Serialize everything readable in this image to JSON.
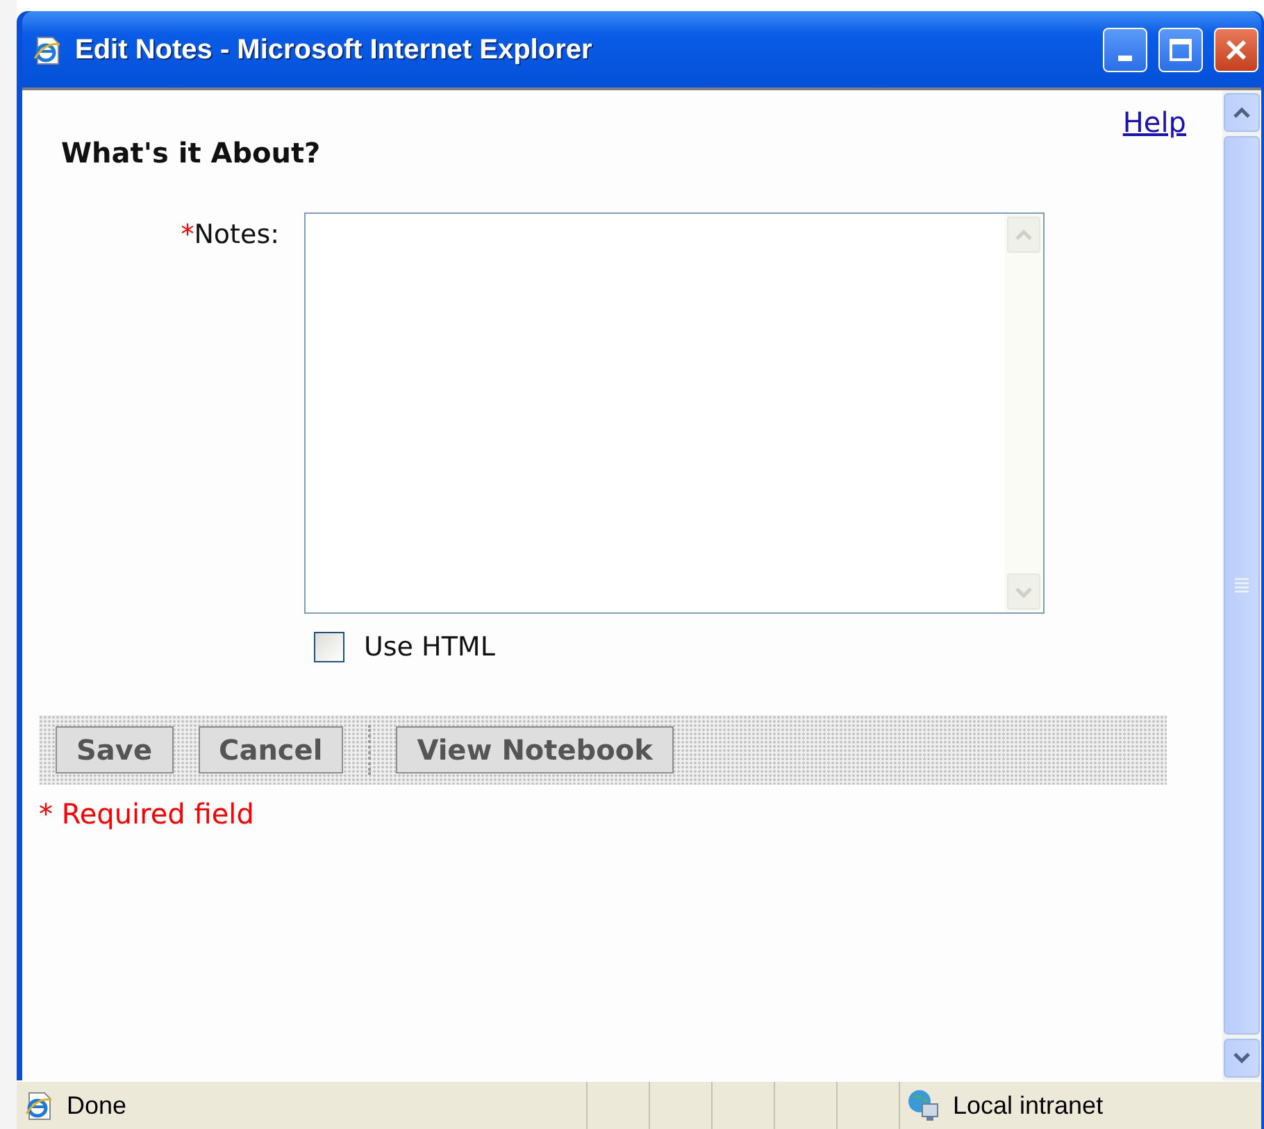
{
  "window": {
    "title": "Edit Notes - Microsoft Internet Explorer"
  },
  "help_link": "Help",
  "heading": "What's it About?",
  "notes_field": {
    "required_mark": "*",
    "label": "Notes:"
  },
  "use_html": {
    "label": "Use HTML",
    "checked": false
  },
  "button_groups": [
    {
      "buttons": [
        "Save",
        "Cancel"
      ]
    },
    {
      "buttons": [
        "View Notebook"
      ]
    }
  ],
  "required_note": "* Required field",
  "status_bar": {
    "status": "Done",
    "zone": "Local intranet"
  }
}
